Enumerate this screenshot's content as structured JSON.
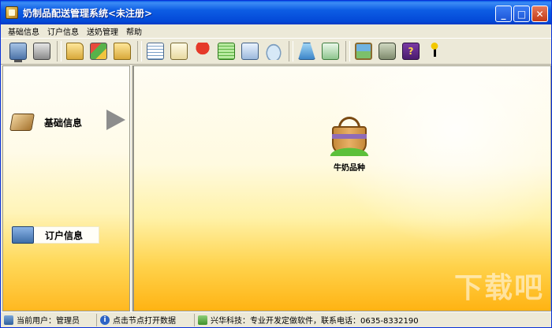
{
  "window": {
    "title": "奶制品配送管理系统<未注册>"
  },
  "title_buttons": {
    "minimize": "_",
    "maximize": "□",
    "close": "✕"
  },
  "menu": [
    "基础信息",
    "订户信息",
    "送奶管理",
    "帮助"
  ],
  "toolbar": {
    "groups": [
      [
        "monitor-icon",
        "printer-icon"
      ],
      [
        "folder-icon",
        "multi-folder-icon",
        "folder-icon"
      ],
      [
        "doc-list-icon",
        "pen-doc-icon",
        "umbrella-icon",
        "green-sheet-icon",
        "search-doc-icon",
        "dish-icon"
      ],
      [
        "cone-icon",
        "envelope-icon"
      ],
      [
        "picture-icon",
        "pda-icon",
        "help-book-icon",
        "exit-icon"
      ]
    ]
  },
  "sidebar": {
    "categories": [
      {
        "label": "基础信息",
        "icon": "box-icon",
        "selected": true
      },
      {
        "label": "订户信息",
        "icon": "order-icon",
        "selected": false
      }
    ]
  },
  "main": {
    "items": [
      {
        "label": "牛奶品种",
        "icon": "milk-bucket-icon"
      }
    ]
  },
  "status": {
    "user": "当前用户：管理员",
    "hint": "点击节点打开数据",
    "company": "兴华科技：专业开发定做软件，联系电话：0635-8332190"
  },
  "watermark": "下载吧"
}
